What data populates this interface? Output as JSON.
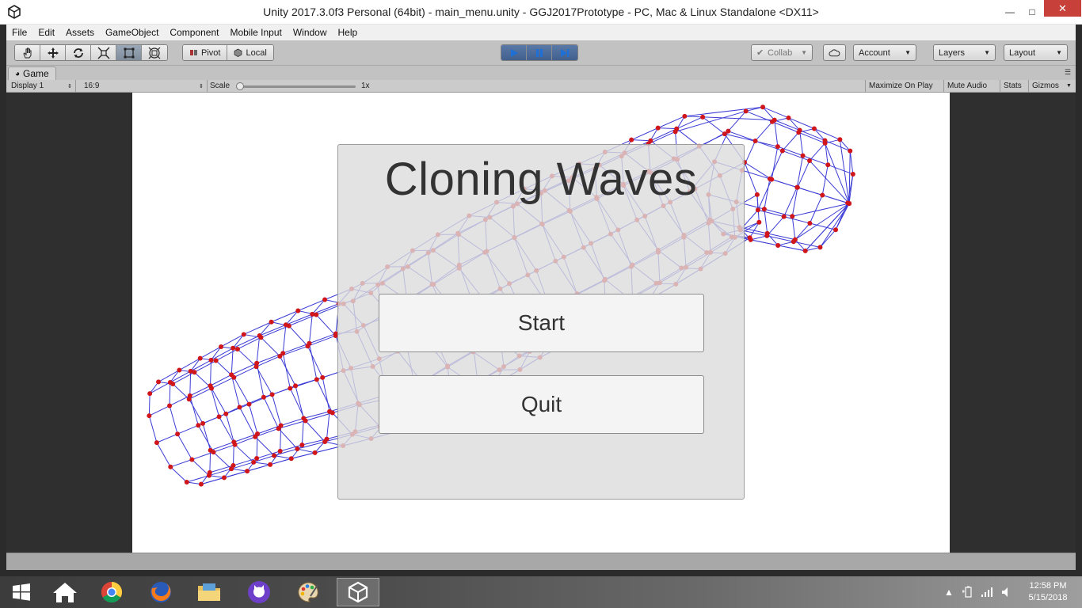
{
  "window": {
    "title": "Unity 2017.3.0f3 Personal (64bit) - main_menu.unity - GGJ2017Prototype - PC, Mac & Linux Standalone <DX11>",
    "minimize_glyph": "—",
    "maximize_glyph": "□",
    "close_glyph": "✕"
  },
  "menubar": {
    "items": [
      "File",
      "Edit",
      "Assets",
      "GameObject",
      "Component",
      "Mobile Input",
      "Window",
      "Help"
    ]
  },
  "toolbar": {
    "tools": [
      "hand-tool",
      "move-tool",
      "rotate-tool",
      "scale-tool",
      "rect-tool",
      "transform-tool"
    ],
    "pivot_label": "Pivot",
    "local_label": "Local",
    "play_state": "playing",
    "collab_label": "Collab",
    "account_label": "Account",
    "layers_label": "Layers",
    "layout_label": "Layout"
  },
  "game_view": {
    "tab_label": "Game",
    "display_label": "Display 1",
    "aspect_label": "16:9",
    "scale_label": "Scale",
    "scale_value": "1x",
    "maximize_label": "Maximize On Play",
    "mute_label": "Mute Audio",
    "stats_label": "Stats",
    "gizmos_label": "Gizmos"
  },
  "game_ui": {
    "title": "Cloning Waves",
    "start_label": "Start",
    "quit_label": "Quit"
  },
  "taskbar": {
    "apps": [
      "start",
      "home",
      "chrome",
      "firefox",
      "file-explorer",
      "github-desktop",
      "paint",
      "unity"
    ],
    "active_app": "unity",
    "time": "12:58 PM",
    "date": "5/15/2018"
  },
  "colors": {
    "mesh_line": "#3b3bd6",
    "mesh_node": "#d0161b",
    "close_button": "#c7403a",
    "play_active": "#4a6a99"
  }
}
